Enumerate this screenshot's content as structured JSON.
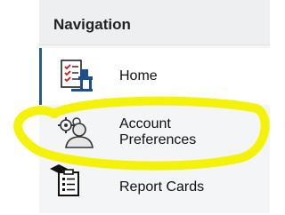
{
  "nav": {
    "title": "Navigation",
    "items": [
      {
        "label": "Home",
        "icon": "checklist-desk-icon",
        "active": true
      },
      {
        "label_line1": "Account",
        "label_line2": "Preferences",
        "icon": "user-gears-icon",
        "active": false
      },
      {
        "label": "Report Cards",
        "icon": "graduation-report-icon",
        "active": false
      }
    ]
  },
  "highlight": {
    "color": "#f5f20a",
    "label": "yellow hand-drawn circle around Account Preferences"
  }
}
